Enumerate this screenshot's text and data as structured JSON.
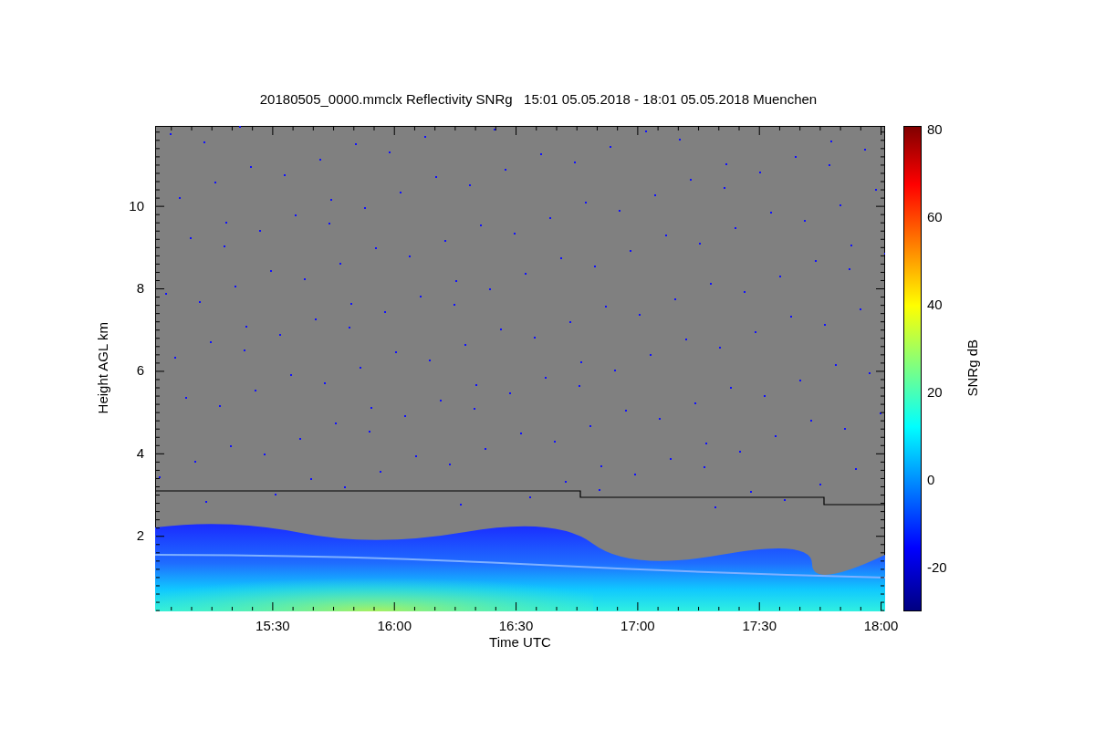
{
  "title": "20180505_0000.mmclx Reflectivity SNRg   15:01 05.05.2018 - 18:01 05.05.2018 Muenchen",
  "y_axis": {
    "label": "Height AGL km",
    "ticks": [
      "10",
      "8",
      "6",
      "4",
      "2"
    ]
  },
  "x_axis": {
    "label": "Time UTC",
    "ticks": [
      "15:30",
      "16:00",
      "16:30",
      "17:00",
      "17:30",
      "18:00"
    ]
  },
  "colorbar": {
    "label": "SNRg dB",
    "ticks": [
      "80",
      "60",
      "40",
      "20",
      "0",
      "-20"
    ]
  }
}
